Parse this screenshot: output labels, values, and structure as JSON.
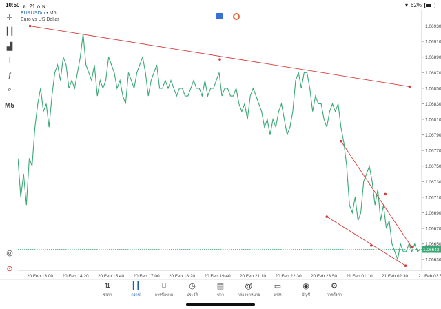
{
  "status_bar": {
    "time": "10:50",
    "date": "อ. 21 ก.พ.",
    "battery": "62%",
    "battery_level": 0.62
  },
  "symbol": {
    "name": "EURUSDm",
    "separator": "•",
    "timeframe": "M5",
    "description": "Euro vs US Dollar"
  },
  "toolbar": {
    "timeframe": "M5"
  },
  "icons": [
    "crosshair-icon",
    "candlestick-icon",
    "bar-chart-icon",
    "indicators-icon",
    "function-icon",
    "objects-icon",
    "timeframe-label",
    "history-icon",
    "quick-trade-icon"
  ],
  "chart_data": {
    "type": "line",
    "price_axis": [
      "1.06930",
      "1.06910",
      "1.06890",
      "1.06870",
      "1.06850",
      "1.06830",
      "1.06810",
      "1.06790",
      "1.06770",
      "1.06750",
      "1.06730",
      "1.06710",
      "1.06690",
      "1.06670",
      "1.06650",
      "1.06630"
    ],
    "ylim": [
      1.06616,
      1.06942
    ],
    "time_axis": [
      "20 Feb 13:00",
      "20 Feb 14:20",
      "20 Feb 15:40",
      "20 Feb 17:00",
      "20 Feb 18:20",
      "20 Feb 19:40",
      "20 Feb 21:10",
      "20 Feb 22:30",
      "20 Feb 23:50",
      "21 Feb 01:10",
      "21 Feb 02:30",
      "21 Feb 03:5"
    ],
    "current_price": "1.06643",
    "series": [
      {
        "color": "#3aa876",
        "values": [
          1.0676,
          1.0671,
          1.0674,
          1.067,
          1.0676,
          1.0675,
          1.068,
          1.0683,
          1.0685,
          1.0682,
          1.0683,
          1.068,
          1.0684,
          1.0687,
          1.0688,
          1.0686,
          1.0689,
          1.0688,
          1.0685,
          1.0686,
          1.0685,
          1.0687,
          1.0689,
          1.0692,
          1.0688,
          1.0687,
          1.0686,
          1.0688,
          1.0684,
          1.0686,
          1.0685,
          1.0686,
          1.0689,
          1.0688,
          1.0687,
          1.0685,
          1.0686,
          1.0684,
          1.0683,
          1.0687,
          1.0686,
          1.0685,
          1.0687,
          1.0688,
          1.0689,
          1.0687,
          1.0684,
          1.0686,
          1.0687,
          1.0688,
          1.0685,
          1.0685,
          1.0686,
          1.0685,
          1.0686,
          1.0685,
          1.0684,
          1.0685,
          1.0685,
          1.0684,
          1.0684,
          1.0685,
          1.0686,
          1.0685,
          1.0685,
          1.0684,
          1.0686,
          1.0684,
          1.0685,
          1.0685,
          1.0686,
          1.0687,
          1.0684,
          1.0685,
          1.0685,
          1.0684,
          1.0684,
          1.0685,
          1.0683,
          1.0682,
          1.0683,
          1.0681,
          1.0684,
          1.0685,
          1.0684,
          1.0683,
          1.0682,
          1.068,
          1.0681,
          1.0679,
          1.0681,
          1.068,
          1.0682,
          1.0683,
          1.0681,
          1.0679,
          1.068,
          1.0682,
          1.0686,
          1.0687,
          1.0685,
          1.0687,
          1.0687,
          1.0685,
          1.0682,
          1.0684,
          1.0683,
          1.0683,
          1.0681,
          1.068,
          1.0682,
          1.0683,
          1.0682,
          1.0683,
          1.068,
          1.0678,
          1.0675,
          1.067,
          1.0669,
          1.0671,
          1.0668,
          1.0669,
          1.0673,
          1.0674,
          1.0675,
          1.0673,
          1.067,
          1.0672,
          1.0668,
          1.067,
          1.0667,
          1.0668,
          1.0665,
          1.0664,
          1.0663,
          1.0665,
          1.0664,
          1.0664,
          1.0665,
          1.0664,
          1.0665,
          1.0664,
          1.06643
        ]
      }
    ],
    "trendlines": [
      {
        "color": "#d23c3c",
        "points": [
          [
            0.03,
            1.0693
          ],
          [
            0.5,
            1.06887
          ],
          [
            0.97,
            1.06852
          ]
        ]
      },
      {
        "color": "#d23c3c",
        "points": [
          [
            0.8,
            1.06782
          ],
          [
            0.91,
            1.06714
          ],
          [
            0.975,
            1.06646
          ]
        ]
      },
      {
        "color": "#d23c3c",
        "points": [
          [
            0.765,
            1.06685
          ],
          [
            0.875,
            1.06648
          ],
          [
            0.96,
            1.06622
          ]
        ]
      }
    ],
    "grid": false
  },
  "nav": [
    {
      "icon": "sort-arrows-icon",
      "label": "ราคา",
      "active": false
    },
    {
      "icon": "candles-icon",
      "label": "กราฟ",
      "active": true
    },
    {
      "icon": "trade-chart-icon",
      "label": "การซื้อขาย",
      "active": false
    },
    {
      "icon": "history-clock-icon",
      "label": "ประวัติ",
      "active": false
    },
    {
      "icon": "news-icon",
      "label": "ข่าว",
      "active": false
    },
    {
      "icon": "mailbox-at-icon",
      "label": "กล่องจดหมาย",
      "active": false
    },
    {
      "icon": "chat-bubble-icon",
      "label": "แชท",
      "active": false
    },
    {
      "icon": "account-icon",
      "label": "บัญชี",
      "active": false
    },
    {
      "icon": "settings-gear-icon",
      "label": "การตั้งค่า",
      "active": false
    }
  ]
}
